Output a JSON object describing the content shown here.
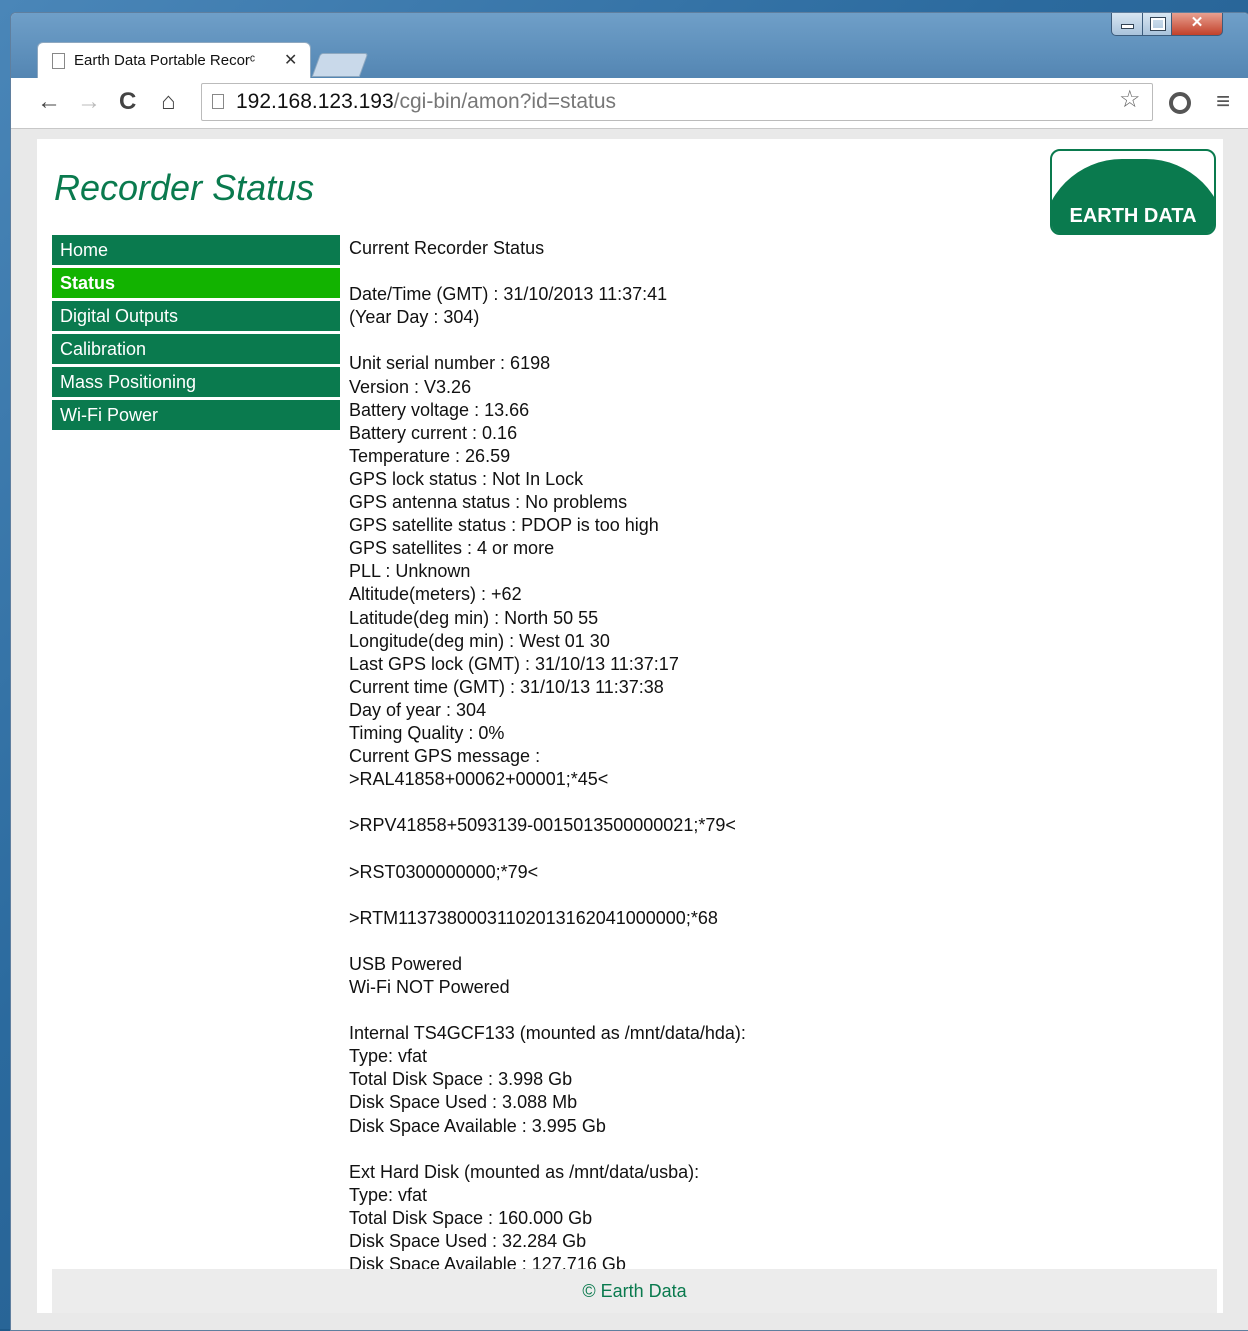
{
  "browser": {
    "tab_title": "Earth Data Portable Recorᶜ",
    "url_host": "192.168.123.193",
    "url_path": "/cgi-bin/amon?id=status"
  },
  "page": {
    "heading": "Recorder Status",
    "logo_text": "EARTH DATA",
    "footer": "© Earth Data"
  },
  "nav": {
    "items": [
      {
        "label": "Home"
      },
      {
        "label": "Status"
      },
      {
        "label": "Digital Outputs"
      },
      {
        "label": "Calibration"
      },
      {
        "label": "Mass Positioning"
      },
      {
        "label": "Wi-Fi Power"
      }
    ]
  },
  "status": {
    "lines": [
      "Current Recorder Status",
      "",
      "Date/Time (GMT) : 31/10/2013 11:37:41",
      "(Year Day : 304)",
      "",
      "Unit serial number : 6198",
      "Version : V3.26",
      "Battery voltage : 13.66",
      "Battery current : 0.16",
      "Temperature : 26.59",
      "GPS lock status : Not In Lock",
      "GPS antenna status : No problems",
      "GPS satellite status : PDOP is too high",
      "GPS satellites : 4 or more",
      "PLL : Unknown",
      "Altitude(meters) : +62",
      "Latitude(deg min) : North 50 55",
      "Longitude(deg min) : West 01 30",
      "Last GPS lock (GMT) : 31/10/13 11:37:17",
      "Current time (GMT) : 31/10/13 11:37:38",
      "Day of year : 304",
      "Timing Quality : 0%",
      "Current GPS message :",
      ">RAL41858+00062+00001;*45<",
      "",
      ">RPV41858+5093139-0015013500000021;*79<",
      "",
      ">RST0300000000;*79<",
      "",
      ">RTM11373800031102013162041000000;*68",
      "",
      "USB Powered",
      "Wi-Fi NOT Powered",
      "",
      "Internal TS4GCF133 (mounted as /mnt/data/hda):",
      "Type: vfat",
      "Total Disk Space : 3.998 Gb",
      "Disk Space Used : 3.088 Mb",
      "Disk Space Available : 3.995 Gb",
      "",
      "Ext Hard Disk (mounted as /mnt/data/usba):",
      "Type: vfat",
      "Total Disk Space : 160.000 Gb",
      "Disk Space Used : 32.284 Gb",
      "Disk Space Available : 127.716 Gb"
    ]
  }
}
